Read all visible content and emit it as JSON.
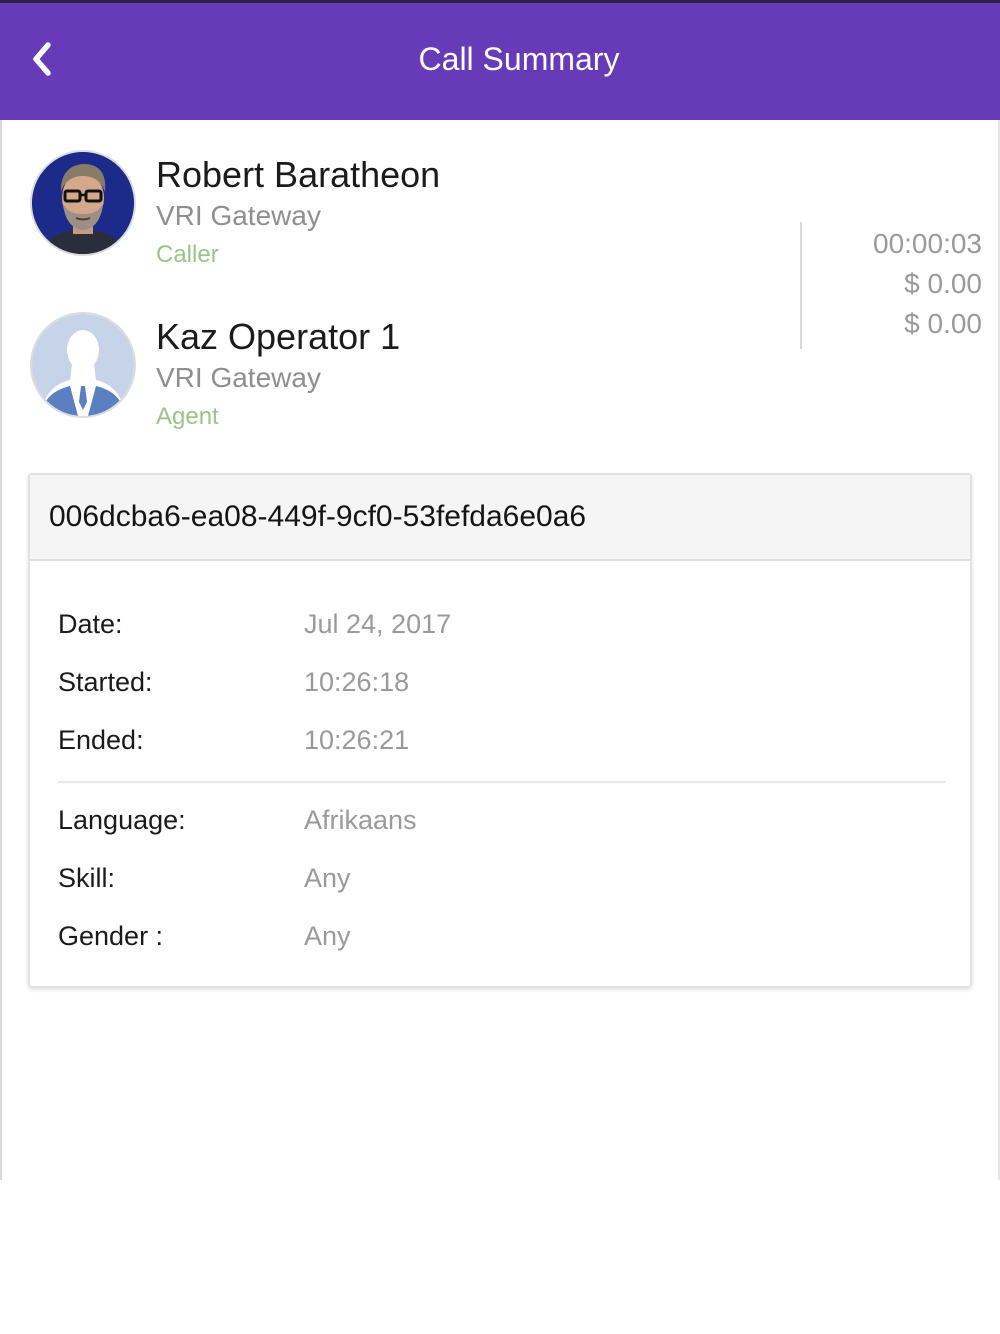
{
  "header": {
    "title": "Call Summary",
    "back_icon": "chevron-left-icon",
    "background_color": "#673ab7"
  },
  "participants": [
    {
      "name": "Robert Baratheon",
      "gateway": "VRI Gateway",
      "role": "Caller",
      "avatar": "person-photo-avatar"
    },
    {
      "name": "Kaz Operator 1",
      "gateway": "VRI Gateway",
      "role": "Agent",
      "avatar": "default-silhouette-avatar"
    }
  ],
  "stats": {
    "duration": "00:00:03",
    "cost_1": "$ 0.00",
    "cost_2": "$ 0.00"
  },
  "call": {
    "id": "006dcba6-ea08-449f-9cf0-53fefda6e0a6",
    "details": [
      {
        "label": "Date:",
        "value": "Jul 24, 2017"
      },
      {
        "label": "Started:",
        "value": "10:26:18"
      },
      {
        "label": "Ended:",
        "value": "10:26:21"
      }
    ],
    "preferences": [
      {
        "label": "Language:",
        "value": "Afrikaans"
      },
      {
        "label": "Skill:",
        "value": "Any"
      },
      {
        "label": "Gender :",
        "value": "Any"
      }
    ]
  },
  "colors": {
    "accent": "#673ab7",
    "role_text": "#9bc48b",
    "muted_text": "#9a9a9a"
  }
}
